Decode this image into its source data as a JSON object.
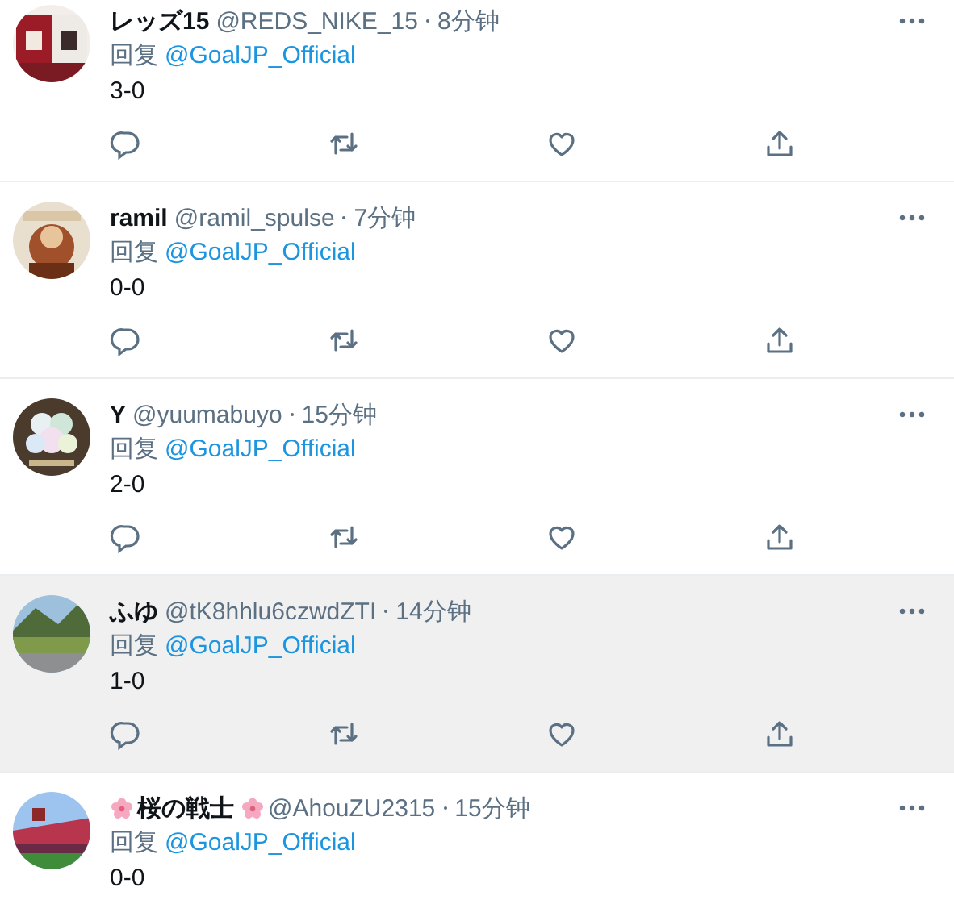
{
  "tweets": [
    {
      "name": "レッズ15",
      "name_flowers": false,
      "handle": "@REDS_NIKE_15",
      "time": "8分钟",
      "reply_prefix": "回复",
      "reply_to": "@GoalJP_Official",
      "text": "3-0",
      "highlighted": false,
      "show_actions": true
    },
    {
      "name": "ramil",
      "name_flowers": false,
      "handle": "@ramil_spulse",
      "time": "7分钟",
      "reply_prefix": "回复",
      "reply_to": "@GoalJP_Official",
      "text": "0-0",
      "highlighted": false,
      "show_actions": true
    },
    {
      "name": "Y",
      "name_flowers": false,
      "handle": "@yuumabuyo",
      "time": "15分钟",
      "reply_prefix": "回复",
      "reply_to": "@GoalJP_Official",
      "text": "2-0",
      "highlighted": false,
      "show_actions": true
    },
    {
      "name": "ふゆ",
      "name_flowers": false,
      "handle": "@tK8hhlu6czwdZTI",
      "time": "14分钟",
      "reply_prefix": "回复",
      "reply_to": "@GoalJP_Official",
      "text": "1-0",
      "highlighted": true,
      "show_actions": true
    },
    {
      "name": "桜の戦士",
      "name_flowers": true,
      "handle": "@AhouZU2315",
      "time": "15分钟",
      "reply_prefix": "回复",
      "reply_to": "@GoalJP_Official",
      "text": "0-0",
      "highlighted": false,
      "show_actions": false
    }
  ]
}
